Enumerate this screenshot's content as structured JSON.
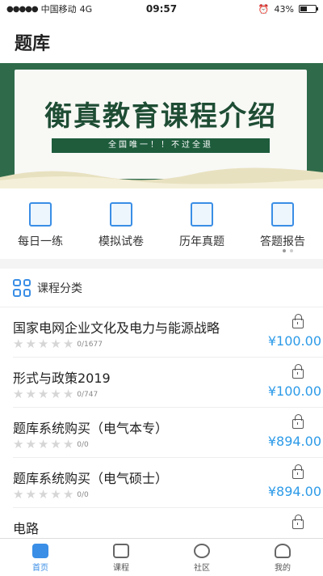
{
  "status": {
    "carrier": "中国移动",
    "network": "4G",
    "time": "09:57",
    "battery": "43%",
    "battery_level": 0.43
  },
  "header": {
    "title": "题库"
  },
  "banner": {
    "title": "衡真教育课程介绍",
    "subtitle": "全国唯一！！不过全退"
  },
  "shortcuts": [
    {
      "label": "每日一练",
      "icon": "daily-practice-icon"
    },
    {
      "label": "模拟试卷",
      "icon": "mock-exam-icon"
    },
    {
      "label": "历年真题",
      "icon": "past-papers-icon"
    },
    {
      "label": "答题报告",
      "icon": "report-chart-icon"
    }
  ],
  "courses_section": {
    "title": "课程分类",
    "items": [
      {
        "name": "国家电网企业文化及电力与能源战略",
        "rating": "0/1677",
        "stars": 0,
        "price": "¥100.00"
      },
      {
        "name": "形式与政策2019",
        "rating": "0/747",
        "stars": 0,
        "price": "¥100.00"
      },
      {
        "name": "题库系统购买（电气本专）",
        "rating": "0/0",
        "stars": 0,
        "price": "¥894.00"
      },
      {
        "name": "题库系统购买（电气硕士）",
        "rating": "0/0",
        "stars": 0,
        "price": "¥894.00"
      },
      {
        "name": "电路",
        "rating": "",
        "stars": 0,
        "price": ""
      }
    ]
  },
  "tabbar": [
    {
      "label": "首页",
      "icon": "home-icon",
      "active": true
    },
    {
      "label": "课程",
      "icon": "course-play-icon",
      "active": false
    },
    {
      "label": "社区",
      "icon": "community-heart-icon",
      "active": false
    },
    {
      "label": "我的",
      "icon": "profile-icon",
      "active": false
    }
  ]
}
